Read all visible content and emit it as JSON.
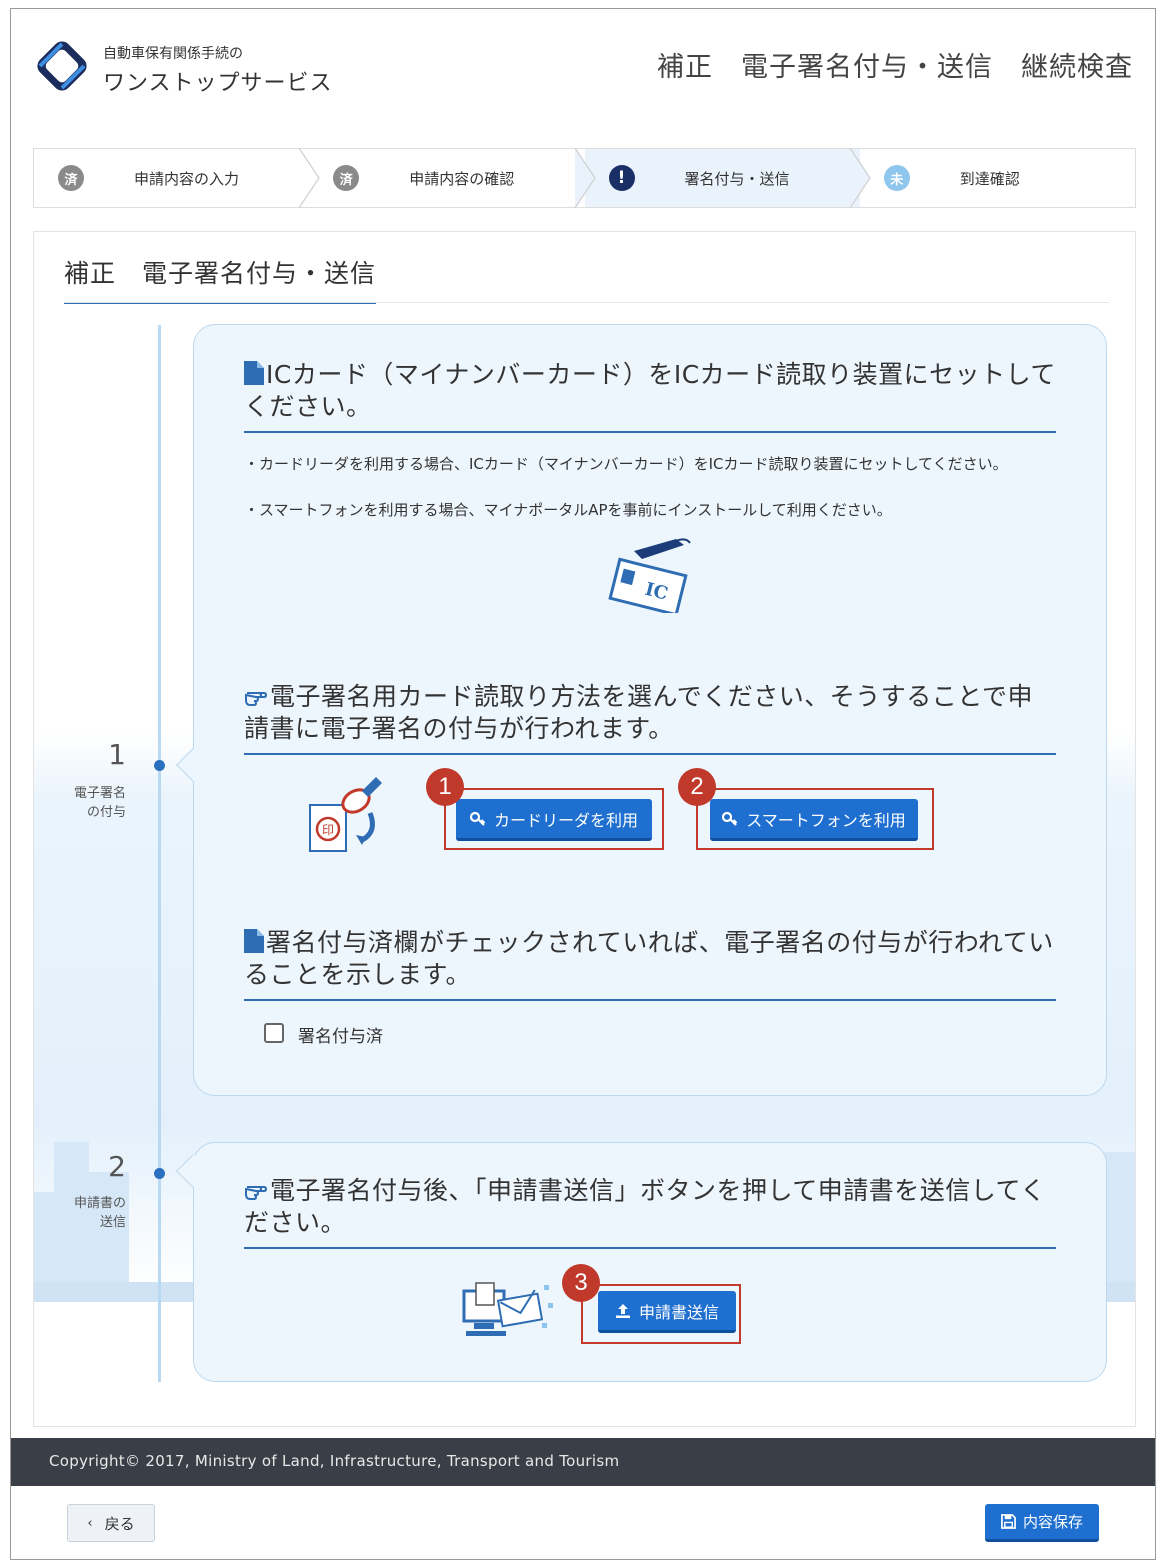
{
  "header": {
    "logo_subtitle": "自動車保有関係手続の",
    "logo_title": "ワンストップサービス",
    "heading_parts": [
      "補正",
      "電子署名付与・送信",
      "継続検査"
    ]
  },
  "steps": [
    {
      "badge": "済",
      "label": "申請内容の入力",
      "state": "done"
    },
    {
      "badge": "済",
      "label": "申請内容の確認",
      "state": "done"
    },
    {
      "badge": "!",
      "label": "署名付与・送信",
      "state": "active"
    },
    {
      "badge": "未",
      "label": "到達確認",
      "state": "pending"
    }
  ],
  "section": {
    "title": "補正　電子署名付与・送信"
  },
  "timeline": [
    {
      "number": "1",
      "label_line1": "電子署名",
      "label_line2": "の付与"
    },
    {
      "number": "2",
      "label_line1": "申請書の",
      "label_line2": "送信"
    }
  ],
  "card1": {
    "heading1": "ICカード（マイナンバーカード）をICカード読取り装置にセットしてください。",
    "instruction1": "・カードリーダを利用する場合、ICカード（マイナンバーカード）をICカード読取り装置にセットしてください。",
    "instruction2": "・スマートフォンを利用する場合、マイナポータルAPを事前にインストールして利用ください。",
    "ic_label": "IC",
    "stamp_label": "印",
    "heading2": "電子署名用カード読取り方法を選んでください、そうすることで申請書に電子署名の付与が行われます。",
    "btn_card_reader": "カードリーダを利用",
    "btn_smartphone": "スマートフォンを利用",
    "heading3": "署名付与済欄がチェックされていれば、電子署名の付与が行われていることを示します。",
    "checkbox_label": "署名付与済"
  },
  "card2": {
    "heading": "電子署名付与後、「申請書送信」ボタンを押して申請書を送信してください。",
    "btn_send": "申請書送信"
  },
  "markers": [
    "1",
    "2",
    "3"
  ],
  "footer": {
    "copyright": "Copyright© 2017, Ministry of Land, Infrastructure, Transport and Tourism",
    "back_label": "戻る",
    "save_label": "内容保存"
  },
  "colors": {
    "accent": "#1e6fd0",
    "highlight": "#c0392b",
    "footer_bg": "#3a3f47",
    "card_bg": "#eef6fd"
  }
}
